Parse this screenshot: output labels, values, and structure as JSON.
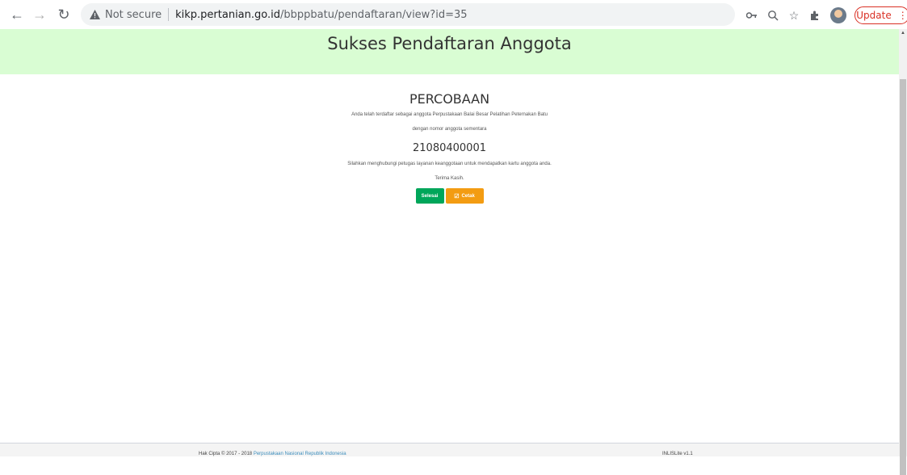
{
  "browser": {
    "not_secure_label": "Not secure",
    "url_host": "kikp.pertanian.go.id",
    "url_path": "/bbppbatu/pendaftaran/view?id=35",
    "update_label": "Update",
    "icons": [
      "back-icon",
      "forward-icon",
      "reload-icon",
      "warning-icon",
      "key-icon",
      "zoom-icon",
      "star-icon",
      "extensions-icon",
      "avatar",
      "menu-icon"
    ]
  },
  "banner": {
    "title": "Sukses Pendaftaran Anggota",
    "background": "#d9fdd3"
  },
  "content": {
    "name": "PERCOBAAN",
    "line1": "Anda telah terdaftar sebagai anggota Perpustakaan Balai Besar Pelatihan Peternakan Batu",
    "line2": "dengan nomor anggota sementara",
    "member_number": "21080400001",
    "line3": "Silahkan menghubungi petugas layanan keanggotaan untuk mendapatkan kartu anggota anda.",
    "line4": "Terima Kasih."
  },
  "buttons": {
    "done_label": "Selesai",
    "print_label": "Cetak",
    "done_color": "#00a65a",
    "print_color": "#f39c12"
  },
  "footer": {
    "copyright": "Hak Cipta © 2017 - 2018",
    "link": "Perpustakaan Nasional Republik Indonesia",
    "version": "INLISLite v1.1"
  }
}
